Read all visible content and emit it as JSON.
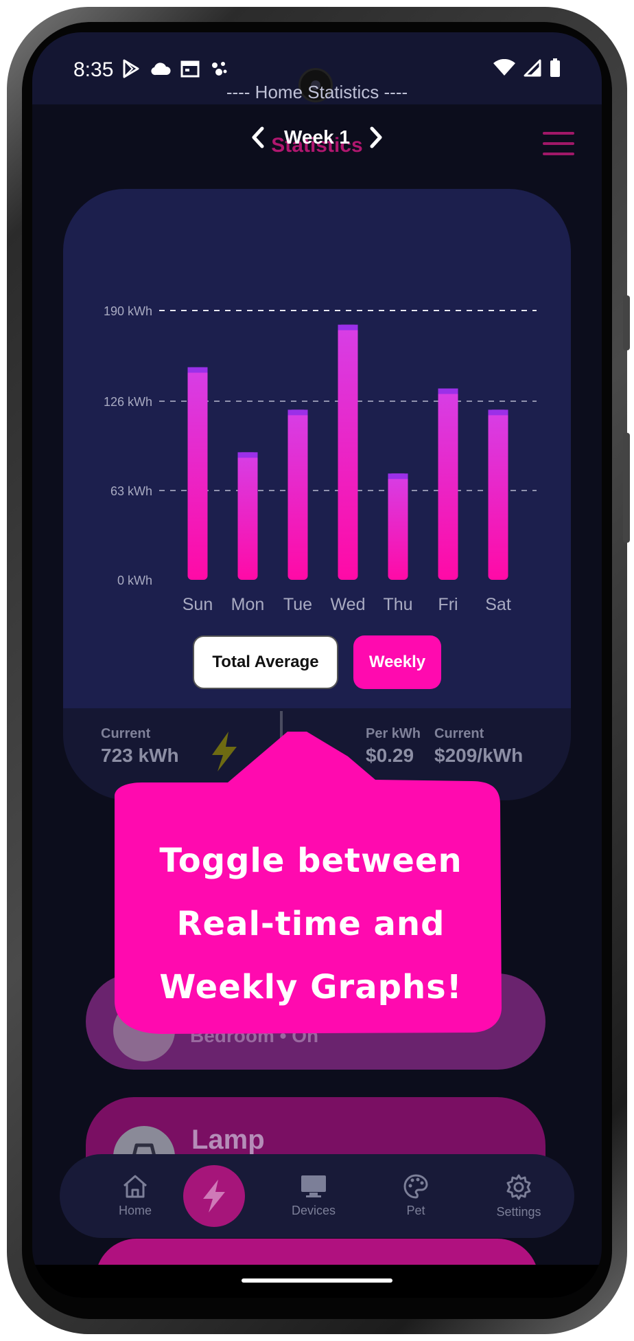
{
  "status_bar": {
    "time": "8:35",
    "left_icons": [
      "play-store-icon",
      "cloud-icon",
      "calendar-icon",
      "assistant-dots-icon"
    ],
    "right_icons": [
      "wifi-icon",
      "signal-icon",
      "battery-icon"
    ]
  },
  "app_bar": {
    "title": "Statistics",
    "menu_icon": "menu-icon"
  },
  "stats_panel": {
    "title": "---- Home Statistics ----",
    "week_label": "Week 1",
    "buttons": {
      "total_average": "Total Average",
      "weekly": "Weekly"
    },
    "selected_mode": "Weekly"
  },
  "chart_data": {
    "type": "bar",
    "categories": [
      "Sun",
      "Mon",
      "Tue",
      "Wed",
      "Thu",
      "Fri",
      "Sat"
    ],
    "values": [
      150,
      90,
      120,
      180,
      75,
      135,
      120
    ],
    "y_ticks": [
      "190 kWh",
      "126 kWh",
      "63 kWh",
      "0 kWh"
    ],
    "y_tick_values": [
      190,
      126,
      63,
      0
    ],
    "ylim": [
      0,
      190
    ],
    "grid": "dashed",
    "colors": {
      "bar_top": "#d63fe6",
      "bar_bottom": "#ff0aa6",
      "cap": "#9b30e8"
    }
  },
  "summary": {
    "current_usage_label": "Current",
    "current_usage_value": "723 kWh",
    "per_kwh_label": "Per kWh",
    "per_kwh_value": "$0.29",
    "current_cost_label": "Current",
    "current_cost_value": "$209/kWh"
  },
  "devices": [
    {
      "subtitle": "Bedroom • On"
    },
    {
      "name": "Lamp"
    }
  ],
  "tip": {
    "lines": [
      "Toggle between",
      "Real-time and",
      "Weekly Graphs!"
    ]
  },
  "bottom_nav": {
    "items": [
      {
        "label": "Home",
        "icon": "home-icon"
      },
      {
        "label": "",
        "icon": "bolt-icon",
        "active": true
      },
      {
        "label": "Devices",
        "icon": "monitor-icon"
      },
      {
        "label": "Pet",
        "icon": "palette-icon"
      },
      {
        "label": "Settings",
        "icon": "gear-icon"
      }
    ]
  },
  "colors": {
    "accent": "#ff0aaf",
    "title": "#b0176f",
    "background": "#0c0d1c",
    "panel": "#1c1f4d"
  }
}
